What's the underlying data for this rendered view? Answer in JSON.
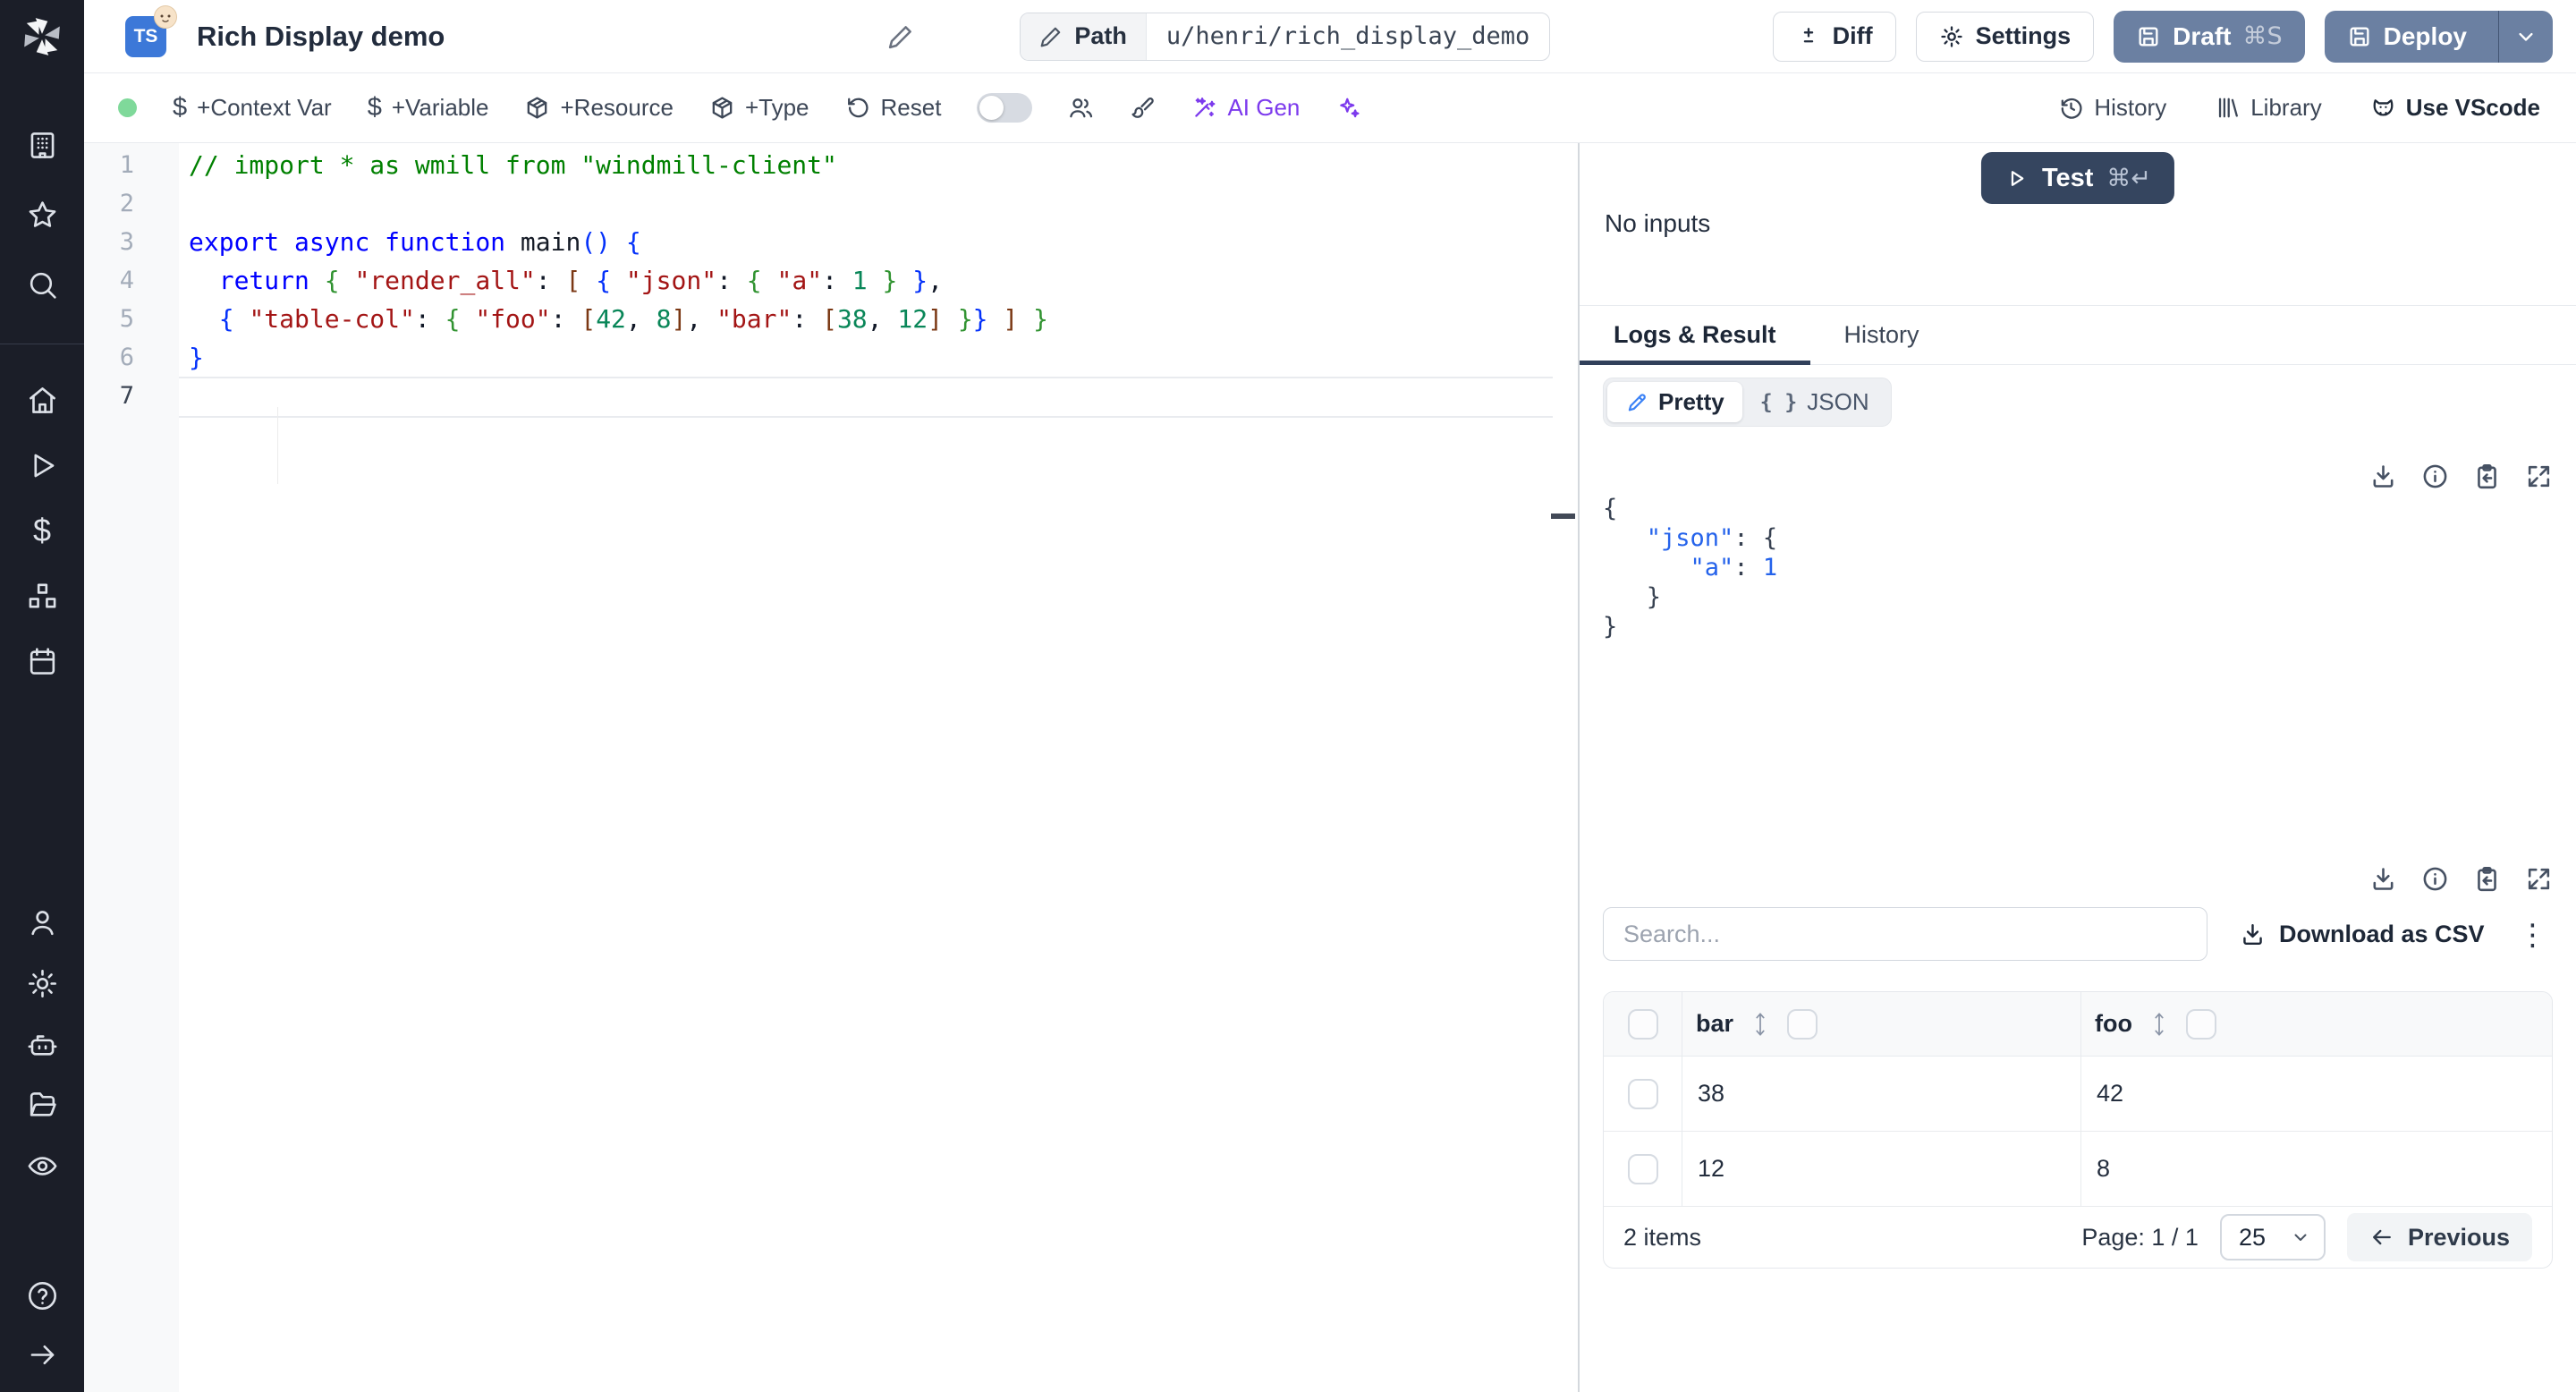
{
  "colors": {
    "sidebar_bg": "#1b1e28",
    "slate_button": "#6b80a2",
    "test_button": "#35455f",
    "accent_blue": "#3b82f6",
    "result_key_blue": "#2563eb",
    "ai_purple": "#7c3aed",
    "status_green": "#7fd99a",
    "code_comment": "#008000",
    "code_keyword": "#0000ff",
    "code_string": "#a31515",
    "code_number": "#098658",
    "bracket_level1": "#0431fa",
    "bracket_level2": "#319331",
    "bracket_level3": "#7b3814"
  },
  "sidebar": {
    "icons": [
      "windmill-logo",
      "building",
      "star",
      "search",
      "home",
      "play",
      "dollar",
      "boxes",
      "calendar",
      "user",
      "settings",
      "bot",
      "folder-open",
      "eye",
      "help",
      "expand-arrow"
    ]
  },
  "topbar": {
    "title": "Rich Display demo",
    "language": "TS",
    "path_label": "Path",
    "path_value": "u/henri/rich_display_demo",
    "diff_label": "Diff",
    "settings_label": "Settings",
    "draft_label": "Draft",
    "draft_shortcut": "⌘S",
    "deploy_label": "Deploy"
  },
  "toolbar": {
    "items": [
      {
        "icon": "dollar",
        "label": "+Context Var"
      },
      {
        "icon": "dollar",
        "label": "+Variable"
      },
      {
        "icon": "package",
        "label": "+Resource"
      },
      {
        "icon": "package",
        "label": "+Type"
      },
      {
        "icon": "rotate-ccw",
        "label": "Reset"
      }
    ],
    "collab_toggle_state": "off",
    "ai_gen_label": "AI Gen",
    "history_label": "History",
    "library_label": "Library",
    "vscode_label": "Use VScode"
  },
  "editor": {
    "active_line": 7,
    "line_numbers": [
      "1",
      "2",
      "3",
      "4",
      "5",
      "6",
      "7"
    ],
    "lines": [
      [
        [
          "c",
          "// import * as wmill from \"windmill-client\""
        ]
      ],
      [],
      [
        [
          "k",
          "export"
        ],
        [
          "p",
          " "
        ],
        [
          "k",
          "async"
        ],
        [
          "p",
          " "
        ],
        [
          "k",
          "function"
        ],
        [
          "p",
          " "
        ],
        [
          "f",
          "main"
        ],
        [
          "b1",
          "()"
        ],
        [
          "p",
          " "
        ],
        [
          "b1",
          "{"
        ]
      ],
      [
        [
          "p",
          "  "
        ],
        [
          "k",
          "return"
        ],
        [
          "p",
          " "
        ],
        [
          "b2",
          "{"
        ],
        [
          "p",
          " "
        ],
        [
          "s",
          "\"render_all\""
        ],
        [
          "p",
          ": "
        ],
        [
          "b3",
          "["
        ],
        [
          "p",
          " "
        ],
        [
          "b1",
          "{"
        ],
        [
          "p",
          " "
        ],
        [
          "s",
          "\"json\""
        ],
        [
          "p",
          ": "
        ],
        [
          "b2",
          "{"
        ],
        [
          "p",
          " "
        ],
        [
          "s",
          "\"a\""
        ],
        [
          "p",
          ": "
        ],
        [
          "n",
          "1"
        ],
        [
          "p",
          " "
        ],
        [
          "b2",
          "}"
        ],
        [
          "p",
          " "
        ],
        [
          "b1",
          "}"
        ],
        [
          "p",
          ","
        ]
      ],
      [
        [
          "p",
          "  "
        ],
        [
          "b1",
          "{"
        ],
        [
          "p",
          " "
        ],
        [
          "s",
          "\"table-col\""
        ],
        [
          "p",
          ": "
        ],
        [
          "b2",
          "{"
        ],
        [
          "p",
          " "
        ],
        [
          "s",
          "\"foo\""
        ],
        [
          "p",
          ": "
        ],
        [
          "b3",
          "["
        ],
        [
          "n",
          "42"
        ],
        [
          "p",
          ", "
        ],
        [
          "n",
          "8"
        ],
        [
          "b3",
          "]"
        ],
        [
          "p",
          ", "
        ],
        [
          "s",
          "\"bar\""
        ],
        [
          "p",
          ": "
        ],
        [
          "b3",
          "["
        ],
        [
          "n",
          "38"
        ],
        [
          "p",
          ", "
        ],
        [
          "n",
          "12"
        ],
        [
          "b3",
          "]"
        ],
        [
          "p",
          " "
        ],
        [
          "b2",
          "}"
        ],
        [
          "b1",
          "}"
        ],
        [
          "p",
          " "
        ],
        [
          "b3",
          "]"
        ],
        [
          "p",
          " "
        ],
        [
          "b2",
          "}"
        ]
      ],
      [
        [
          "b1",
          "}"
        ]
      ],
      []
    ]
  },
  "run": {
    "test_label": "Test",
    "test_shortcut": "⌘↵",
    "no_inputs_label": "No inputs"
  },
  "tabs": {
    "logs_result_label": "Logs & Result",
    "history_label": "History",
    "active": "Logs & Result"
  },
  "result": {
    "pretty_label": "Pretty",
    "json_label": "JSON",
    "json_glyph": "{ }",
    "actions": [
      "download",
      "info",
      "copy-to-clipboard",
      "expand"
    ],
    "json_lines": [
      [
        [
          "pu",
          "{"
        ]
      ],
      [
        [
          "pu",
          "   "
        ],
        [
          "key",
          "\"json\""
        ],
        [
          "pu",
          ": {"
        ]
      ],
      [
        [
          "pu",
          "      "
        ],
        [
          "key",
          "\"a\""
        ],
        [
          "pu",
          ": "
        ],
        [
          "num",
          "1"
        ]
      ],
      [
        [
          "pu",
          "   }"
        ]
      ],
      [
        [
          "pu",
          "}"
        ]
      ]
    ]
  },
  "table": {
    "actions": [
      "download",
      "info",
      "copy-to-clipboard",
      "expand"
    ],
    "search_placeholder": "Search...",
    "download_csv_label": "Download as CSV",
    "columns": [
      "bar",
      "foo"
    ],
    "rows": [
      [
        "38",
        "42"
      ],
      [
        "12",
        "8"
      ]
    ],
    "items_count": "2 items",
    "page_label": "Page: 1 / 1",
    "page_size": "25",
    "previous_label": "Previous"
  }
}
